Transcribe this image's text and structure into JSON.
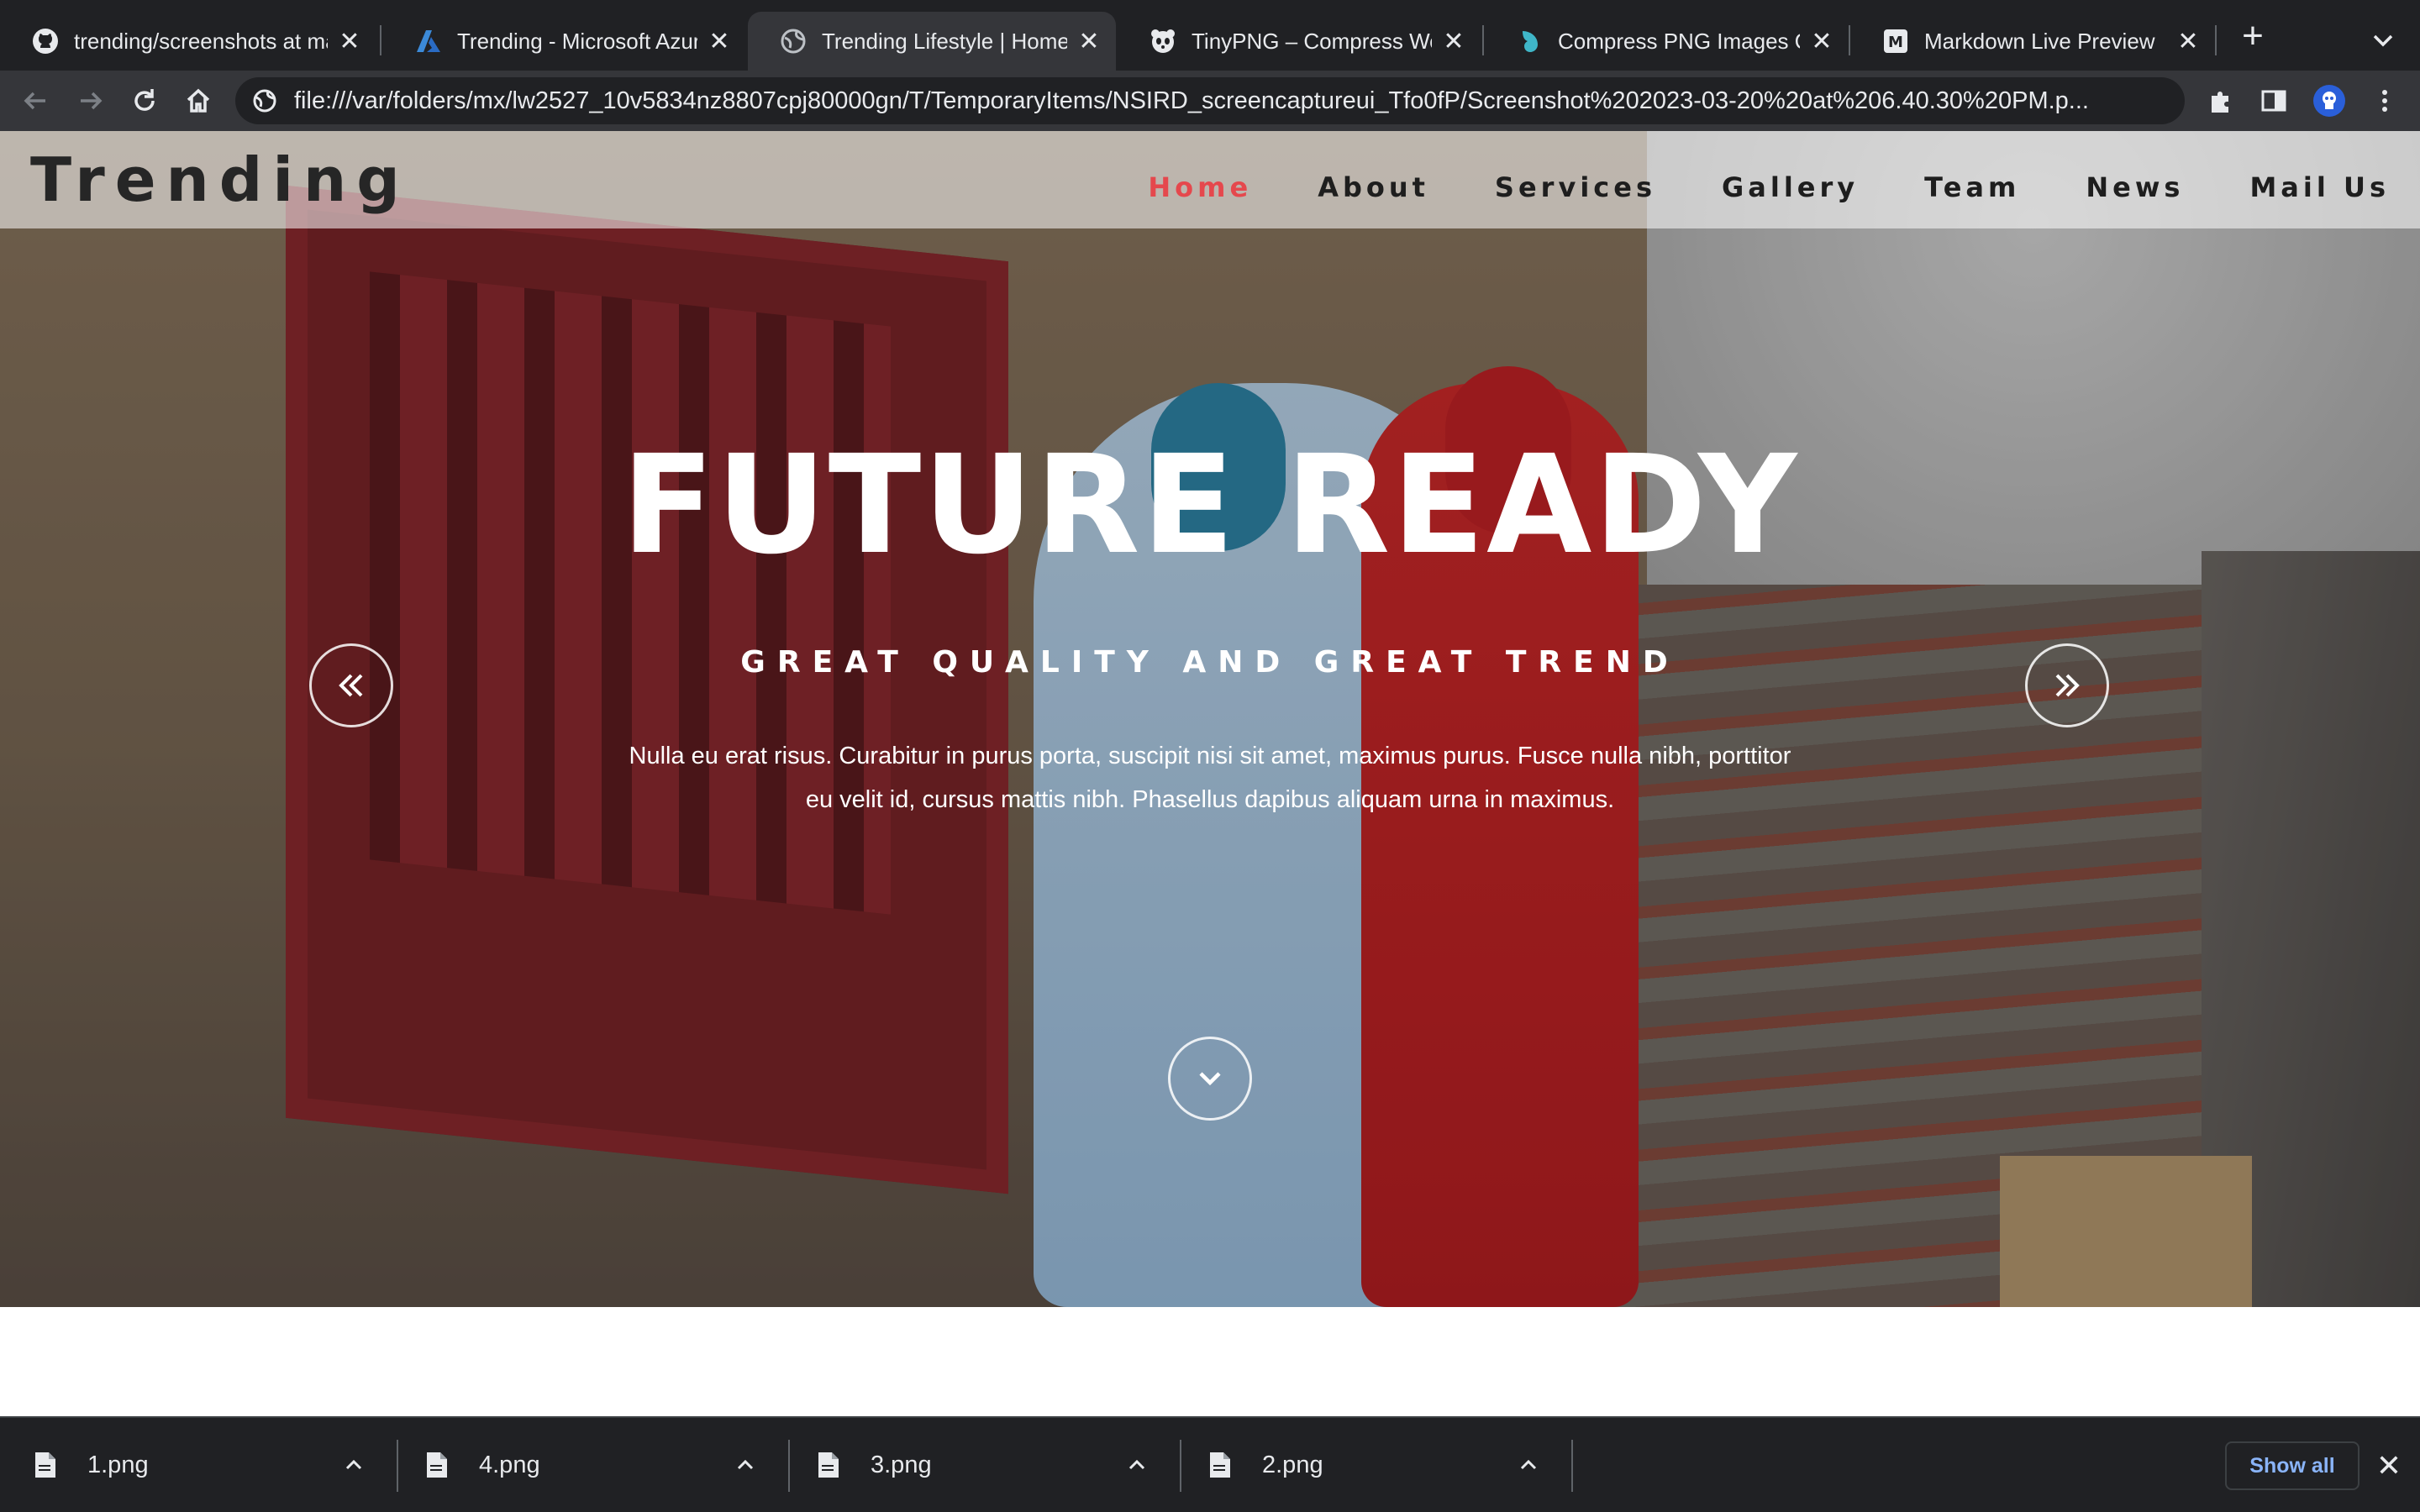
{
  "browser": {
    "tabs": [
      {
        "title": "trending/screenshots at ma",
        "icon": "github-icon"
      },
      {
        "title": "Trending - Microsoft Azure",
        "icon": "azure-icon"
      },
      {
        "title": "Trending Lifestyle | Home",
        "icon": "globe-icon",
        "active": true
      },
      {
        "title": "TinyPNG – Compress WebP",
        "icon": "panda-icon"
      },
      {
        "title": "Compress PNG Images Onl",
        "icon": "compresspng-icon"
      },
      {
        "title": "Markdown Live Preview",
        "icon": "markdown-icon"
      }
    ],
    "new_tab_label": "+",
    "close_glyph": "✕",
    "url": "file:///var/folders/mx/lw2527_10v5834nz8807cpj80000gn/T/TemporaryItems/NSIRD_screencaptureui_Tfo0fP/Screenshot%202023-03-20%20at%206.40.30%20PM.p..."
  },
  "site": {
    "brand": "Trending",
    "nav": [
      {
        "label": "Home",
        "active": true
      },
      {
        "label": "About"
      },
      {
        "label": "Services"
      },
      {
        "label": "Gallery"
      },
      {
        "label": "Team"
      },
      {
        "label": "News"
      },
      {
        "label": "Mail Us"
      }
    ],
    "hero": {
      "title": "FUTURE READY",
      "subtitle": "GREAT QUALITY AND GREAT TREND",
      "body": "Nulla eu erat risus. Curabitur in purus porta, suscipit nisi sit amet, maximus purus. Fusce nulla nibh, porttitor eu velit id, cursus mattis nibh. Phasellus dapibus aliquam urna in maximus."
    },
    "accent_color": "#e5484d"
  },
  "downloads": {
    "items": [
      {
        "name": "1.png"
      },
      {
        "name": "4.png"
      },
      {
        "name": "3.png"
      },
      {
        "name": "2.png"
      }
    ],
    "show_all_label": "Show all"
  }
}
